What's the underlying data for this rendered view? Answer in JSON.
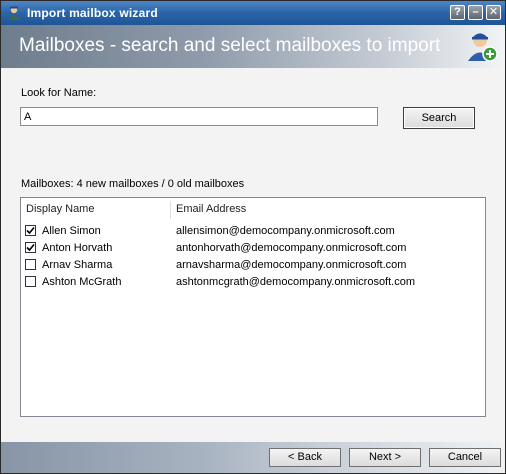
{
  "window": {
    "title": "Import mailbox wizard",
    "help_glyph": "?",
    "minimize_glyph": "–",
    "close_glyph": "✕"
  },
  "banner": {
    "title": "Mailboxes - search and select mailboxes to import"
  },
  "search": {
    "label": "Look for Name:",
    "value": "A",
    "button_label": "Search"
  },
  "mailboxes": {
    "summary": "Mailboxes: 4 new mailboxes / 0 old mailboxes",
    "columns": [
      "Display Name",
      "Email Address"
    ],
    "rows": [
      {
        "checked": true,
        "name": "Allen Simon",
        "email": "allensimon@democompany.onmicrosoft.com"
      },
      {
        "checked": true,
        "name": "Anton Horvath",
        "email": "antonhorvath@democompany.onmicrosoft.com"
      },
      {
        "checked": false,
        "name": "Arnav Sharma",
        "email": "arnavsharma@democompany.onmicrosoft.com"
      },
      {
        "checked": false,
        "name": "Ashton McGrath",
        "email": "ashtonmcgrath@democompany.onmicrosoft.com"
      }
    ]
  },
  "footer": {
    "back_label": "< Back",
    "next_label": "Next >",
    "cancel_label": "Cancel"
  },
  "icons": {
    "app": "user-mailbox-icon",
    "banner": "user-add-icon"
  },
  "colors": {
    "titlebar": "#2a64a8",
    "banner_start": "#6e7d8d",
    "accent_green": "#3a9a3a"
  }
}
